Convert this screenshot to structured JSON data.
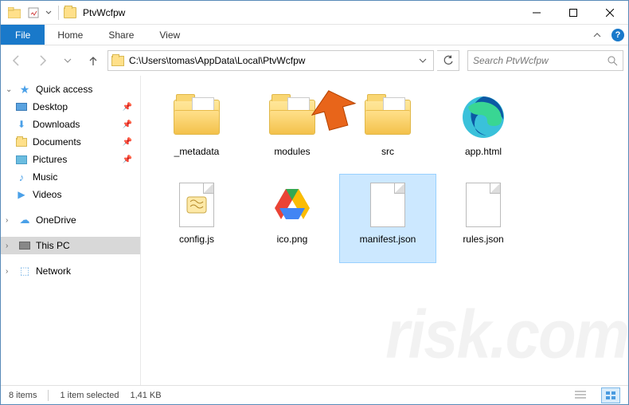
{
  "window": {
    "title": "PtvWcfpw"
  },
  "ribbon": {
    "file": "File",
    "tabs": [
      "Home",
      "Share",
      "View"
    ]
  },
  "nav": {
    "path": "C:\\Users\\tomas\\AppData\\Local\\PtvWcfpw",
    "search_placeholder": "Search PtvWcfpw"
  },
  "sidebar": {
    "quick_access": "Quick access",
    "items": [
      {
        "label": "Desktop",
        "pinned": true
      },
      {
        "label": "Downloads",
        "pinned": true
      },
      {
        "label": "Documents",
        "pinned": true
      },
      {
        "label": "Pictures",
        "pinned": true
      },
      {
        "label": "Music",
        "pinned": false
      },
      {
        "label": "Videos",
        "pinned": false
      }
    ],
    "onedrive": "OneDrive",
    "thispc": "This PC",
    "network": "Network"
  },
  "files": [
    {
      "name": "_metadata",
      "type": "folder"
    },
    {
      "name": "modules",
      "type": "folder"
    },
    {
      "name": "src",
      "type": "folder"
    },
    {
      "name": "app.html",
      "type": "edge"
    },
    {
      "name": "config.js",
      "type": "js"
    },
    {
      "name": "ico.png",
      "type": "drive-img"
    },
    {
      "name": "manifest.json",
      "type": "file",
      "selected": true
    },
    {
      "name": "rules.json",
      "type": "file"
    }
  ],
  "status": {
    "count": "8 items",
    "selection": "1 item selected",
    "size": "1,41 KB"
  }
}
